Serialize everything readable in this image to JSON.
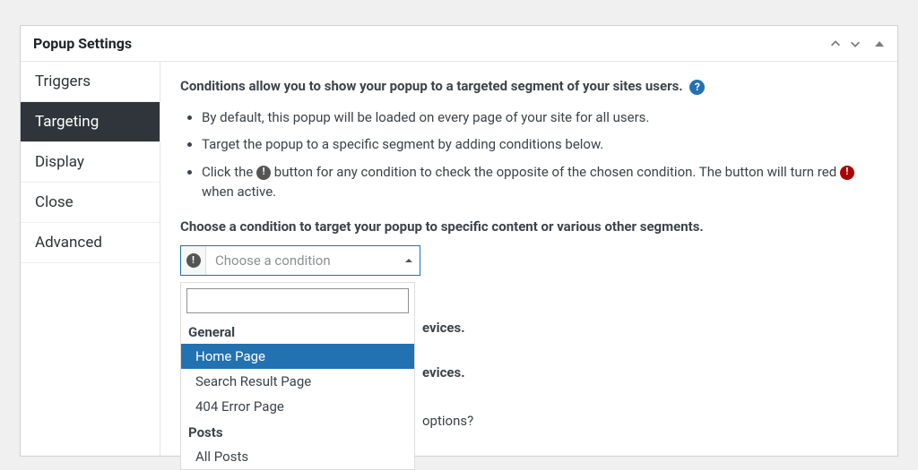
{
  "panel": {
    "title": "Popup Settings",
    "tabs": [
      {
        "label": "Triggers"
      },
      {
        "label": "Targeting"
      },
      {
        "label": "Display"
      },
      {
        "label": "Close"
      },
      {
        "label": "Advanced"
      }
    ],
    "active_tab_index": 1
  },
  "content": {
    "intro_bold": "Conditions allow you to show your popup to a targeted segment of your sites users.",
    "bullets": [
      "By default, this popup will be loaded on every page of your site for all users.",
      "Target the popup to a specific segment by adding conditions below."
    ],
    "bullet_not_prefix": "Click the ",
    "bullet_not_suffix": " button for any condition to check the opposite of the chosen condition. The button will turn red ",
    "bullet_not_tail": " when active.",
    "choose_condition_heading": "Choose a condition to target your popup to specific content or various other segments.",
    "select_placeholder": "Choose a condition",
    "dropdown": {
      "search_value": "",
      "groups": [
        {
          "label": "General",
          "options": [
            "Home Page",
            "Search Result Page",
            "404 Error Page"
          ]
        },
        {
          "label": "Posts",
          "options": [
            "All Posts"
          ]
        }
      ],
      "highlighted_path": "0.0"
    },
    "behind_fragment_1": "evices.",
    "behind_fragment_2": "evices.",
    "behind_fragment_3": "options?"
  }
}
